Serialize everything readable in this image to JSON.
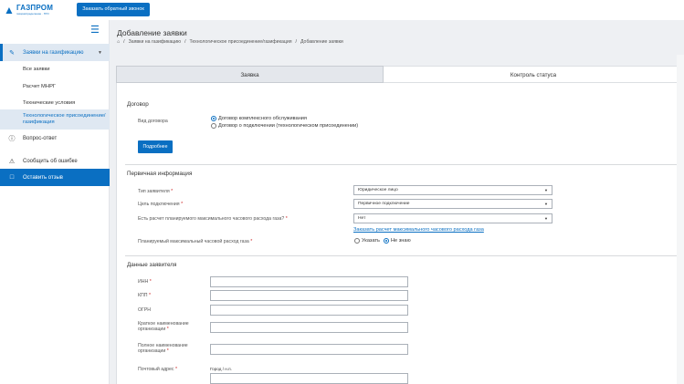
{
  "brand": {
    "name": "ГАЗПРОМ",
    "sub": "газораспределение · ГРО"
  },
  "header": {
    "callback_button": "Заказать обратный звонок"
  },
  "sidebar": {
    "section": "Заявки на газификацию",
    "sub_items": [
      "Все заявки",
      "Расчет МНРГ",
      "Технические условия",
      "Технологическое присоединение/газификация"
    ],
    "items": [
      "Вопрос-ответ",
      "Сообщить об ошибке",
      "Оставить отзыв"
    ]
  },
  "page": {
    "title": "Добавление заявки",
    "breadcrumb": [
      "Заявки на газификацию",
      "Технологическое присоединение/газификация",
      "Добавление заявки"
    ]
  },
  "tabs": [
    "Заявка",
    "Контроль статуса"
  ],
  "contract": {
    "title": "Договор",
    "type_label": "Вид договора",
    "options": [
      "Договор комплексного обслуживания",
      "Договор о подключении (технологическом присоединении)"
    ],
    "selected": 0,
    "more_button": "Подробнее"
  },
  "primary": {
    "title": "Первичная информация",
    "applicant_type_label": "Тип заявителя",
    "applicant_type_value": "Юридическое лицо",
    "purpose_label": "Цель подключения",
    "purpose_value": "Первичное подключение",
    "calc_label": "Есть расчет планируемого максимального часового расхода газа?",
    "calc_value": "Нет",
    "calc_link": "Заказать расчет максимального часового расхода газа",
    "planned_label": "Планируемый максимальный часовой расход газа",
    "planned_options": [
      "Указать",
      "Не знаю"
    ],
    "planned_selected": 1
  },
  "applicant": {
    "title": "Данные заявителя",
    "fields": [
      "ИНН",
      "КПП",
      "ОГРН",
      "Краткое наименование организации",
      "Полное наименование организации",
      "Почтовый адрес"
    ],
    "address_sublabel": "Город / н.п."
  },
  "required_mark": "*"
}
